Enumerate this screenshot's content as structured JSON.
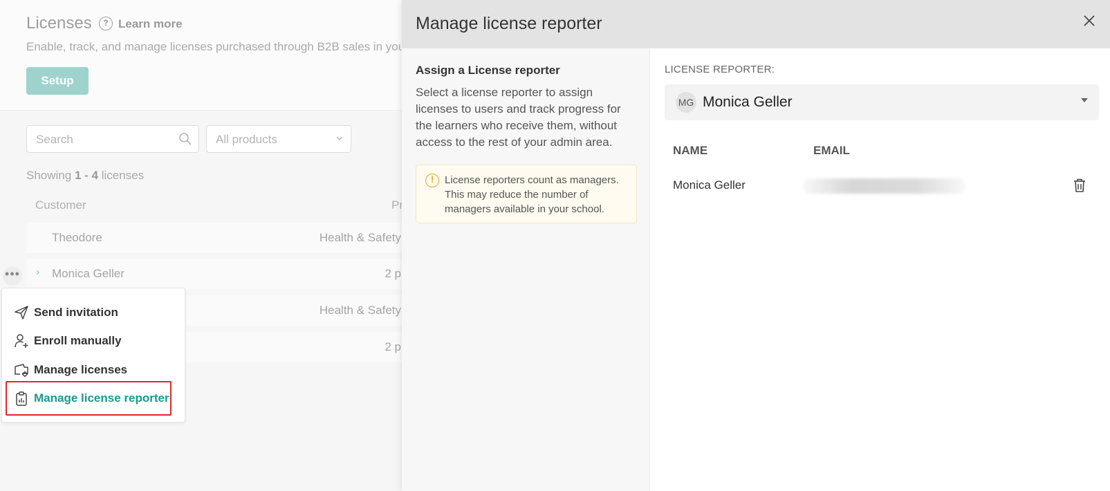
{
  "background": {
    "title": "Licenses",
    "learn_more": "Learn more",
    "description": "Enable, track, and manage licenses purchased through B2B sales in you",
    "setup_button": "Setup",
    "search_placeholder": "Search",
    "products_filter": "All products",
    "showing": {
      "prefix": "Showing ",
      "range": "1 - 4",
      "suffix": " licenses"
    },
    "columns": {
      "customer": "Customer",
      "product": "Pr"
    },
    "rows": [
      {
        "customer": "Theodore",
        "product": "Health & Safety"
      },
      {
        "customer": "Monica Geller",
        "product": "2 p"
      },
      {
        "customer": "",
        "product": "Health & Safety"
      },
      {
        "customer": "",
        "product": "2 p"
      }
    ],
    "more_actions": "•••"
  },
  "context_menu": {
    "items": [
      {
        "label": "Send invitation",
        "icon": "paper-plane-icon"
      },
      {
        "label": "Enroll manually",
        "icon": "user-plus-icon"
      },
      {
        "label": "Manage licenses",
        "icon": "ticket-gear-icon"
      },
      {
        "label": "Manage license reporter",
        "icon": "clipboard-chart-icon",
        "active": true
      }
    ]
  },
  "panel": {
    "title": "Manage license reporter",
    "left": {
      "heading": "Assign a License reporter",
      "description": "Select a license reporter to assign licenses to users and track progress for the learners who receive them, without access to the rest of your admin area.",
      "warning": "License reporters count as managers. This may reduce the number of managers available in your school."
    },
    "right": {
      "reporter_label": "LICENSE REPORTER:",
      "selected": {
        "initials": "MG",
        "name": "Monica Geller"
      },
      "table_headers": {
        "name": "NAME",
        "email": "EMAIL"
      },
      "rows": [
        {
          "name": "Monica Geller",
          "email": ""
        }
      ]
    }
  },
  "colors": {
    "accent": "#199a8c",
    "highlight": "#e2262b",
    "warning": "#e9a417"
  }
}
